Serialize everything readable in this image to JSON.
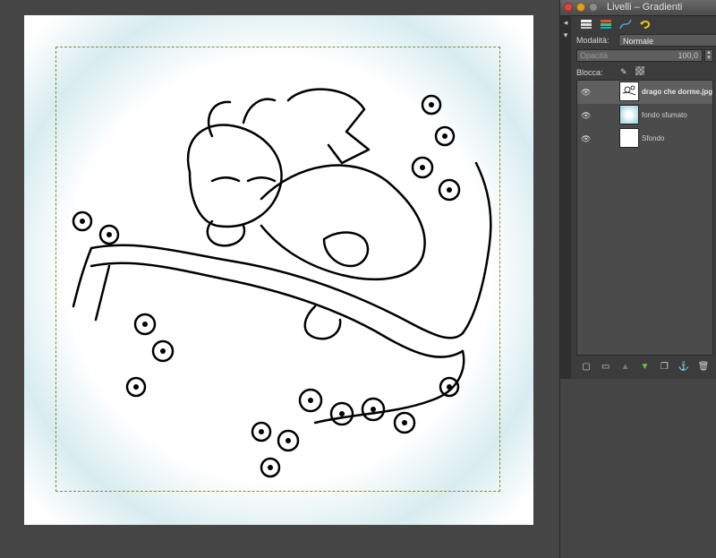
{
  "window": {
    "title": "Livelli – Gradienti"
  },
  "tabs": [
    {
      "icon": "layers-icon"
    },
    {
      "icon": "channels-icon"
    },
    {
      "icon": "paths-icon"
    },
    {
      "icon": "undo-history-icon"
    }
  ],
  "mode": {
    "label": "Modalità:",
    "value": "Normale"
  },
  "opacity": {
    "label": "Opacità",
    "value": "100,0"
  },
  "lock": {
    "label": "Blocca:"
  },
  "layers": [
    {
      "name": "drago che dorme.jpg",
      "thumb": "lineart",
      "selected": true
    },
    {
      "name": "fondo sfumato",
      "thumb": "gradient",
      "selected": false
    },
    {
      "name": "Sfondo",
      "thumb": "white",
      "selected": false
    }
  ],
  "bottom_actions": [
    "new-layer-icon",
    "new-group-icon",
    "raise-layer-icon",
    "lower-layer-icon",
    "duplicate-layer-icon",
    "anchor-layer-icon",
    "delete-layer-icon"
  ],
  "colors": {
    "accent_green": "#6cc24a",
    "selection": "#8a8a2a",
    "glow": "#d8ecf0"
  }
}
